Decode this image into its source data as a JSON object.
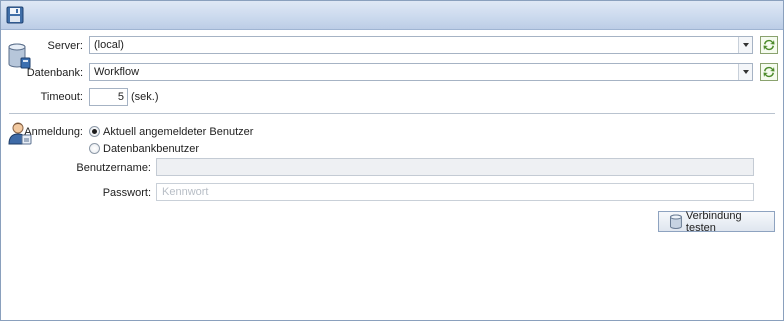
{
  "toolbar": {
    "save_icon": "floppy-disk-icon"
  },
  "connection": {
    "icon": "database-server-icon",
    "server_label": "Server:",
    "server_value": "(local)",
    "database_label": "Datenbank:",
    "database_value": "Workflow",
    "refresh_icon": "refresh-icon",
    "timeout_label": "Timeout:",
    "timeout_value": "5",
    "timeout_unit": "(sek.)"
  },
  "login": {
    "icon": "user-login-icon",
    "label": "Anmeldung:",
    "options": [
      {
        "label": "Aktuell angemeldeter Benutzer",
        "checked": true
      },
      {
        "label": "Datenbankbenutzer",
        "checked": false
      }
    ],
    "username_label": "Benutzername:",
    "username_value": "",
    "password_label": "Passwort:",
    "password_placeholder": "Kennwort"
  },
  "test_button": {
    "label": "Verbindung testen",
    "icon": "database-icon"
  },
  "colors": {
    "accent": "#4c7a2a",
    "toolbar": "#ccdaee",
    "border": "#8aa0bd"
  }
}
